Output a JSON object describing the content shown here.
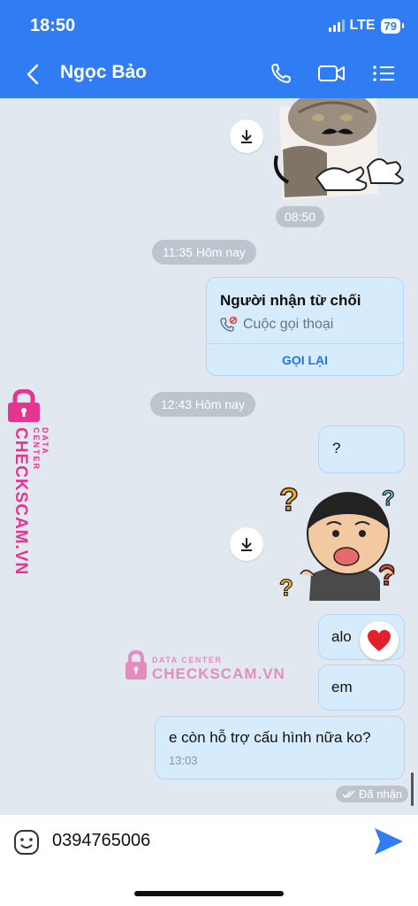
{
  "status_bar": {
    "time": "18:50",
    "network": "LTE",
    "battery": "79"
  },
  "header": {
    "contact_name": "Ngọc Bảo"
  },
  "messages": {
    "sticker_time": "08:50",
    "date_1": "11:35 Hôm nay",
    "call_card": {
      "title": "Người nhận từ chối",
      "subtitle": "Cuộc gọi thoại",
      "action": "GỌI LẠI"
    },
    "date_2": "12:43 Hôm nay",
    "msg_question": "?",
    "msg_alo": "alo",
    "msg_em": "em",
    "msg_last": "e còn hỗ trợ cấu hình nữa ko?",
    "msg_last_time": "13:03",
    "seen_status": "Đã nhận"
  },
  "watermark": {
    "sub": "DATA CENTER",
    "main": "CHECKSCAM.VN"
  },
  "composer": {
    "text": "0394765006"
  },
  "colors": {
    "header": "#2f7cf3",
    "bubble": "#d6ebfc",
    "background": "#e2e8ef",
    "watermark": "#e5358f"
  }
}
